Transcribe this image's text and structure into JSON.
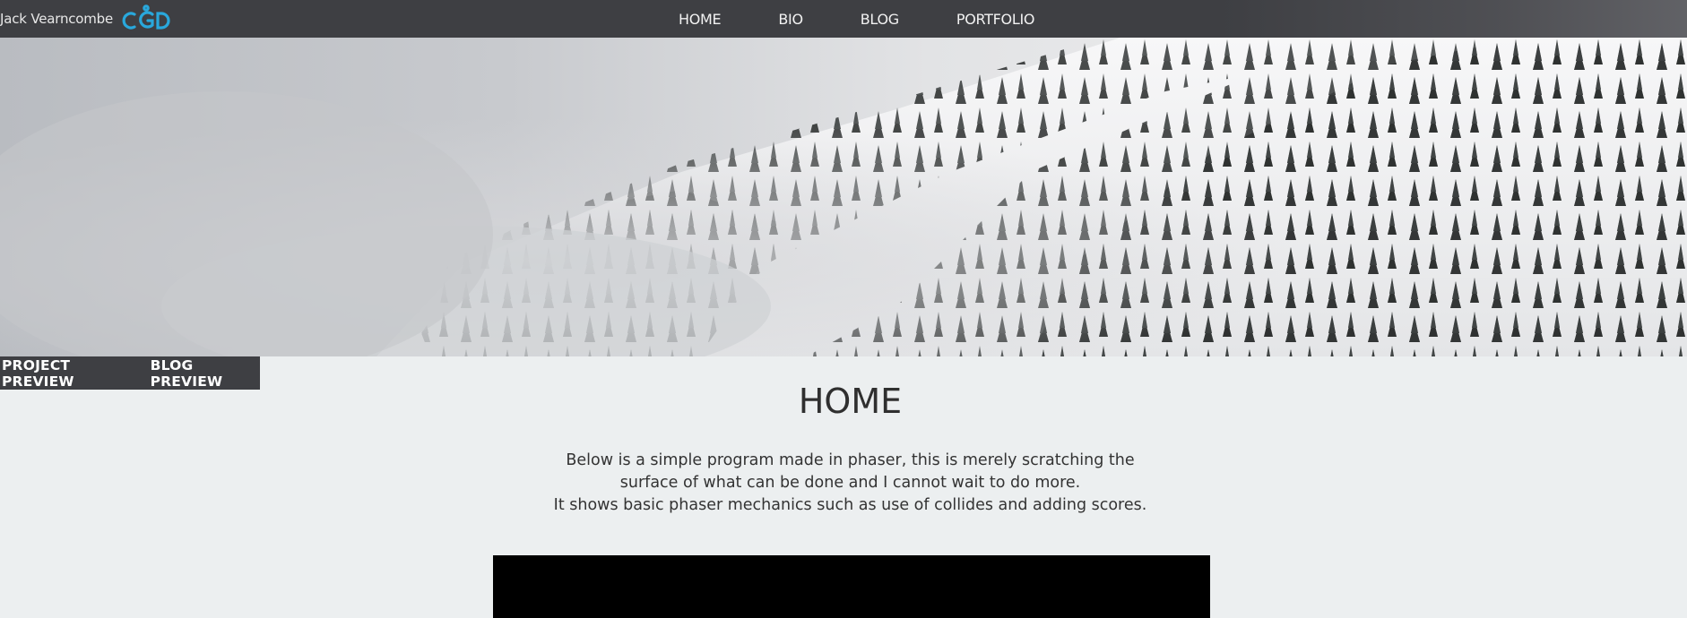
{
  "brand": {
    "name": "Jack Vearncombe",
    "logo_text": "CGD",
    "logo_color": "#29a8dc"
  },
  "nav": {
    "items": [
      "HOME",
      "BIO",
      "BLOG",
      "PORTFOLIO"
    ]
  },
  "hero": {
    "image": "snowy-mountain-forest-banner"
  },
  "subtabs": {
    "items": [
      "PROJECT PREVIEW",
      "BLOG PREVIEW"
    ]
  },
  "main": {
    "title": "HOME",
    "intro_lines": [
      "Below is a simple program made in phaser, this is merely scratching the",
      "surface of what can be done and I cannot wait to do more.",
      "It shows basic phaser mechanics such as use of collides and adding scores."
    ]
  },
  "colors": {
    "topbar": "#3e3f43",
    "page_bg": "#eceff0",
    "canvas": "#000000"
  }
}
